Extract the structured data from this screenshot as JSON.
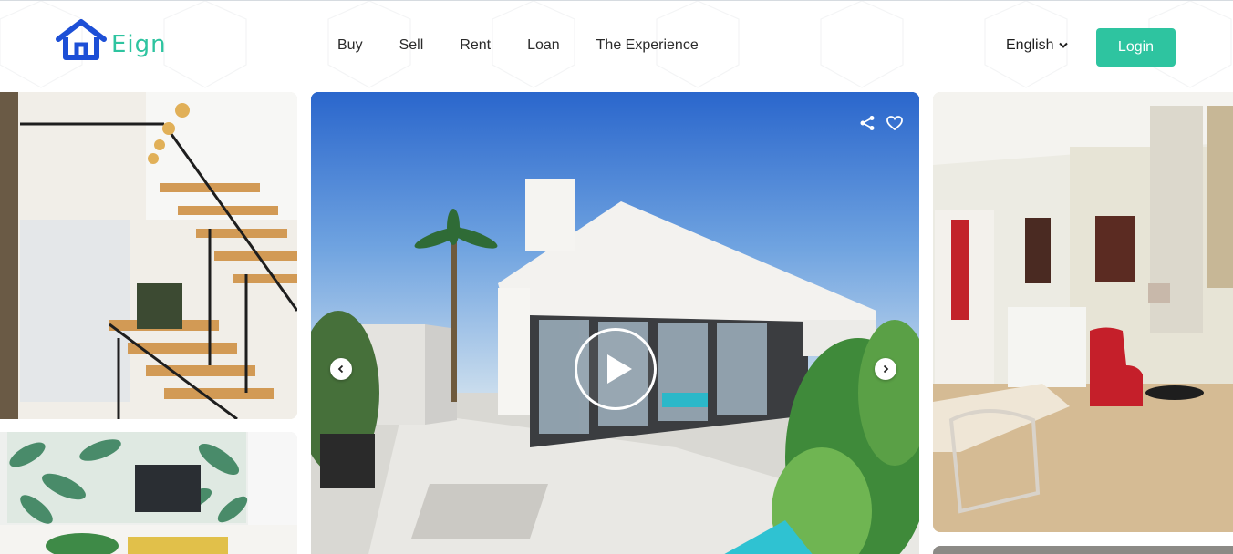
{
  "brand": {
    "name": "Eign",
    "color": "#2ec4a0",
    "logo_icon": "house-icon",
    "logo_icon_color": "#1d4fd6"
  },
  "nav": {
    "items": [
      {
        "label": "Buy"
      },
      {
        "label": "Sell"
      },
      {
        "label": "Rent"
      },
      {
        "label": "Loan"
      },
      {
        "label": "The Experience"
      }
    ]
  },
  "language": {
    "selected": "English",
    "icon": "chevron-down-icon"
  },
  "login": {
    "label": "Login",
    "color": "#2ec4a0"
  },
  "gallery": {
    "images": [
      {
        "subject": "staircase-interior"
      },
      {
        "subject": "leaf-wallpaper-living-room"
      },
      {
        "subject": "modern-villa-exterior"
      },
      {
        "subject": "living-room-red-armchair"
      },
      {
        "subject": "room-partial"
      }
    ],
    "main_controls": {
      "share_icon": "share-icon",
      "favorite_icon": "heart-icon",
      "play_icon": "play-icon",
      "prev_icon": "chevron-left-icon",
      "next_icon": "chevron-right-icon"
    }
  }
}
